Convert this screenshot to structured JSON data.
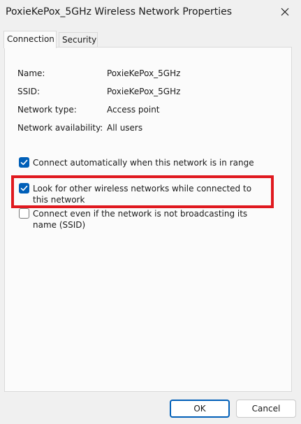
{
  "window": {
    "title": "PoxieKePox_5GHz Wireless Network Properties"
  },
  "tabs": [
    {
      "label": "Connection",
      "active": true
    },
    {
      "label": "Security",
      "active": false
    }
  ],
  "info": [
    {
      "label": "Name:",
      "value": "PoxieKePox_5GHz"
    },
    {
      "label": "SSID:",
      "value": "PoxieKePox_5GHz"
    },
    {
      "label": "Network type:",
      "value": "Access point"
    },
    {
      "label": "Network availability:",
      "value": "All users"
    }
  ],
  "options": [
    {
      "label": "Connect automatically when this network is in range",
      "checked": true
    },
    {
      "label": "Look for other wireless networks while connected to this network",
      "checked": true
    },
    {
      "label": "Connect even if the network is not broadcasting its name (SSID)",
      "checked": false
    }
  ],
  "buttons": {
    "ok": "OK",
    "cancel": "Cancel"
  },
  "colors": {
    "accent": "#005fb8",
    "highlight": "#e0191f"
  },
  "icons": {
    "close": "close-icon",
    "check": "checkmark-icon"
  }
}
